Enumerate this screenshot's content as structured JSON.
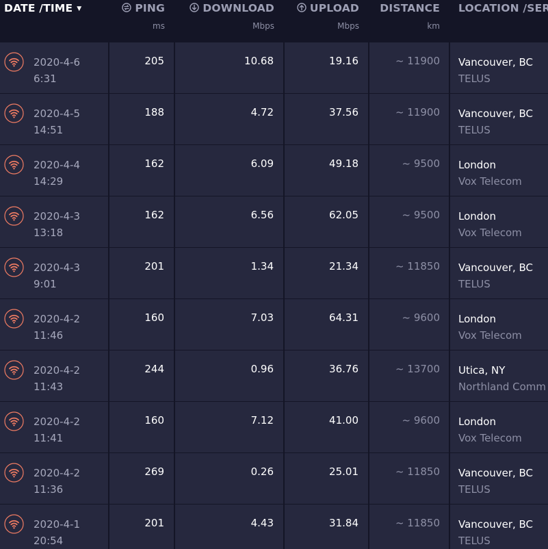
{
  "colors": {
    "background": "#141526",
    "row_background": "#26283e",
    "accent_icon": "#f07c63",
    "header_text": "#9d9fb4",
    "value_text": "#ffffff",
    "muted_text": "#8d8fa5"
  },
  "header": {
    "date_time": {
      "label": "DATE /TIME",
      "sort_icon": "sort-desc-arrow"
    },
    "ping": {
      "label": "PING",
      "unit": "ms",
      "icon": "ping-icon"
    },
    "download": {
      "label": "DOWNLOAD",
      "unit": "Mbps",
      "icon": "download-icon"
    },
    "upload": {
      "label": "UPLOAD",
      "unit": "Mbps",
      "icon": "upload-icon"
    },
    "distance": {
      "label": "DISTANCE",
      "unit": "km"
    },
    "location": {
      "label": "LOCATION /SER"
    }
  },
  "rows": [
    {
      "icon": "wifi-icon",
      "date": "2020-4-6",
      "time": "6:31",
      "ping": "205",
      "download": "10.68",
      "upload": "19.16",
      "distance": "~ 11900",
      "city": "Vancouver, BC",
      "isp": "TELUS"
    },
    {
      "icon": "wifi-icon",
      "date": "2020-4-5",
      "time": "14:51",
      "ping": "188",
      "download": "4.72",
      "upload": "37.56",
      "distance": "~ 11900",
      "city": "Vancouver, BC",
      "isp": "TELUS"
    },
    {
      "icon": "wifi-icon",
      "date": "2020-4-4",
      "time": "14:29",
      "ping": "162",
      "download": "6.09",
      "upload": "49.18",
      "distance": "~ 9500",
      "city": "London",
      "isp": "Vox Telecom"
    },
    {
      "icon": "wifi-icon",
      "date": "2020-4-3",
      "time": "13:18",
      "ping": "162",
      "download": "6.56",
      "upload": "62.05",
      "distance": "~ 9500",
      "city": "London",
      "isp": "Vox Telecom"
    },
    {
      "icon": "wifi-icon",
      "date": "2020-4-3",
      "time": "9:01",
      "ping": "201",
      "download": "1.34",
      "upload": "21.34",
      "distance": "~ 11850",
      "city": "Vancouver, BC",
      "isp": "TELUS"
    },
    {
      "icon": "wifi-icon",
      "date": "2020-4-2",
      "time": "11:46",
      "ping": "160",
      "download": "7.03",
      "upload": "64.31",
      "distance": "~ 9600",
      "city": "London",
      "isp": "Vox Telecom"
    },
    {
      "icon": "wifi-icon",
      "date": "2020-4-2",
      "time": "11:43",
      "ping": "244",
      "download": "0.96",
      "upload": "36.76",
      "distance": "~ 13700",
      "city": "Utica, NY",
      "isp": "Northland Comm"
    },
    {
      "icon": "wifi-icon",
      "date": "2020-4-2",
      "time": "11:41",
      "ping": "160",
      "download": "7.12",
      "upload": "41.00",
      "distance": "~ 9600",
      "city": "London",
      "isp": "Vox Telecom"
    },
    {
      "icon": "wifi-icon",
      "date": "2020-4-2",
      "time": "11:36",
      "ping": "269",
      "download": "0.26",
      "upload": "25.01",
      "distance": "~ 11850",
      "city": "Vancouver, BC",
      "isp": "TELUS"
    },
    {
      "icon": "wifi-icon",
      "date": "2020-4-1",
      "time": "20:54",
      "ping": "201",
      "download": "4.43",
      "upload": "31.84",
      "distance": "~ 11850",
      "city": "Vancouver, BC",
      "isp": "TELUS"
    }
  ]
}
